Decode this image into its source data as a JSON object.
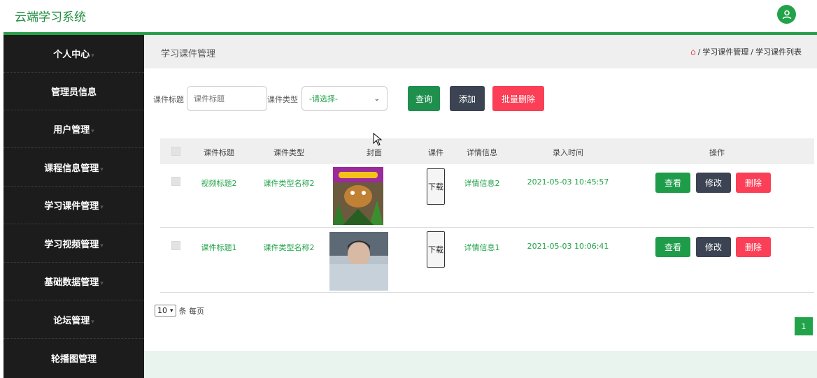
{
  "app": {
    "title": "云端学习系统"
  },
  "sidebar": {
    "items": [
      {
        "label": "个人中心",
        "caret": true
      },
      {
        "label": "管理员信息",
        "caret": false
      },
      {
        "label": "用户管理",
        "caret": true
      },
      {
        "label": "课程信息管理",
        "caret": true
      },
      {
        "label": "学习课件管理",
        "caret": true
      },
      {
        "label": "学习视频管理",
        "caret": true
      },
      {
        "label": "基础数据管理",
        "caret": true
      },
      {
        "label": "论坛管理",
        "caret": true
      },
      {
        "label": "轮播图管理",
        "caret": false
      }
    ]
  },
  "header": {
    "page_title": "学习课件管理",
    "breadcrumb": {
      "level1": "学习课件管理",
      "level2": "学习课件列表",
      "sep": "/"
    }
  },
  "filters": {
    "title_label": "课件标题",
    "title_placeholder": "课件标题",
    "type_label": "课件类型",
    "type_selected": "-请选择-",
    "search_button": "查询",
    "add_button": "添加",
    "bulk_delete_button": "批量删除"
  },
  "table": {
    "columns": [
      "课件标题",
      "课件类型",
      "封面",
      "课件",
      "详情信息",
      "录入时间",
      "操作"
    ],
    "rows": [
      {
        "title": "视频标题2",
        "type": "课件类型名称2",
        "download": "下载",
        "detail": "详情信息2",
        "time": "2021-05-03 10:45:57"
      },
      {
        "title": "课件标题1",
        "type": "课件类型名称2",
        "download": "下载",
        "detail": "详情信息1",
        "time": "2021-05-03 10:06:41"
      }
    ],
    "actions": {
      "view": "查看",
      "edit": "修改",
      "delete": "删除"
    }
  },
  "pagination": {
    "page_size": "10",
    "per_page_label": "条 每页",
    "current_page": "1"
  },
  "colors": {
    "brand_green": "#22a34a",
    "sidebar_bg": "#1c1c1c",
    "danger": "#fa3f56",
    "dark_button": "#3c4352"
  }
}
